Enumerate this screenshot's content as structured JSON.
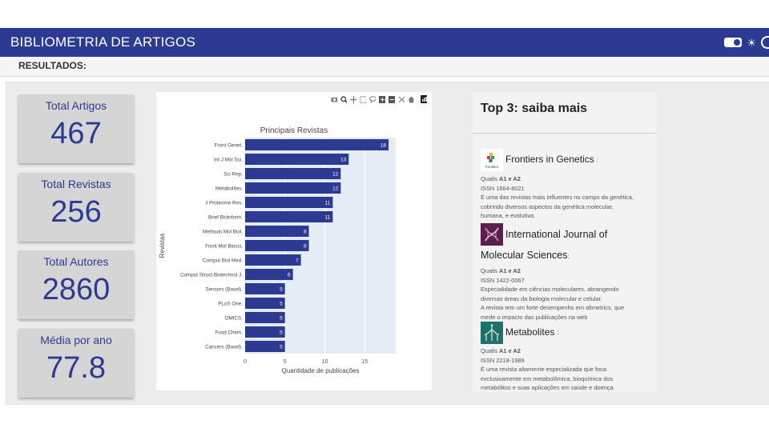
{
  "app": {
    "title": "BIBLIOMETRIA DE ARTIGOS"
  },
  "theme_toggle": {
    "icons": [
      "toggle-icon",
      "sun-icon",
      "moon-icon"
    ]
  },
  "results": {
    "label": "RESULTADOS:"
  },
  "stats": [
    {
      "label": "Total Artigos",
      "value": "467"
    },
    {
      "label": "Total Revistas",
      "value": "256"
    },
    {
      "label": "Total Autores",
      "value": "2860"
    },
    {
      "label": "Média por ano",
      "value": "77.8"
    }
  ],
  "chart_data": {
    "type": "bar",
    "orientation": "horizontal",
    "title": "Principais Revistas",
    "xlabel": "Quantidade de publicações",
    "ylabel": "Revistas",
    "categories": [
      "Front Genet.",
      "Int J Mol Sci.",
      "Sci Rep.",
      "Metabolites.",
      "J Proteome Res.",
      "Brief Bioinform.",
      "Methods Mol Biol.",
      "Front Mol Biosci.",
      "Comput Biol Med.",
      "Comput Struct Biotechnol J.",
      "Sensors (Basel).",
      "PLoS One.",
      "OMICS.",
      "Food Chem.",
      "Cancers (Basel)."
    ],
    "values": [
      18,
      13,
      12,
      12,
      11,
      11,
      8,
      8,
      7,
      6,
      5,
      5,
      5,
      5,
      5
    ],
    "xticks": [
      0,
      5,
      10,
      15
    ],
    "xlim": [
      0,
      18.9
    ],
    "bar_color": "#2c3a92",
    "plot_bg": "#e5ecf6",
    "grid": true
  },
  "modebar": [
    "camera-icon",
    "zoom-icon",
    "pan-icon",
    "box-select-icon",
    "lasso-icon",
    "zoom-in-icon",
    "zoom-out-icon",
    "autoscale-icon",
    "reset-icon",
    "plotly-logo-icon"
  ],
  "top3": {
    "title": "Top 3: saiba mais",
    "journals": [
      {
        "name": "Frontiers in Genetics",
        "suffix": ":",
        "qualis_prefix": "Qualis ",
        "qualis": "A1 e A2",
        "issn": "ISSN 1664-8021",
        "desc": [
          "É uma das revistas mais influentes no campo da genética,",
          "cobrindo diversos aspectos da genética molecular,",
          "humana, e evolutiva."
        ],
        "logo": "frontiers-logo",
        "logo_text": "frontiers"
      },
      {
        "name_line1": "International Journal of",
        "name_line2": "Molecular Sciences",
        "suffix": ":",
        "qualis_prefix": "Qualis ",
        "qualis": "A1 e A2",
        "issn": "ISSN 1422-0067",
        "desc": [
          "Especialidade em ciências moleculares, abrangendo",
          "diversas áreas da biologia molecular e celular.",
          "A revista tem um forte desempenho em altmetrics, que",
          "mede o impacto das publicações na web"
        ],
        "logo": "ijms-logo"
      },
      {
        "name": "Metabolites",
        "suffix": ":",
        "qualis_prefix": "Qualis ",
        "qualis": "A1 e A2",
        "issn": "ISSN 2218-1989",
        "desc": [
          "É uma revista altamente especializada que foca",
          "exclusivamente em metabolômica, bioquímica dos",
          "metabólitos e suas aplicações em saúde e doença."
        ],
        "logo": "metabolites-logo"
      }
    ]
  },
  "colors": {
    "header": "#2c3a92",
    "accent": "#2c3a92",
    "card_bg": "#d5d5d5"
  }
}
